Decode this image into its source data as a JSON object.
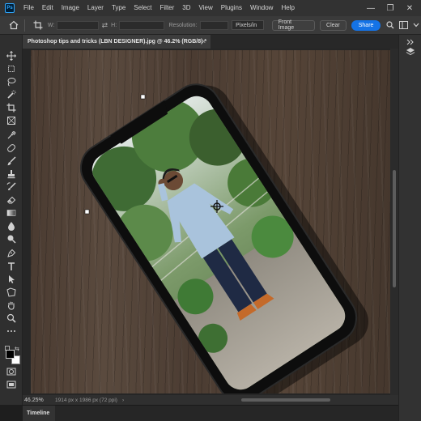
{
  "menubar": {
    "logo": "Ps",
    "items": [
      "File",
      "Edit",
      "Image",
      "Layer",
      "Type",
      "Select",
      "Filter",
      "3D",
      "View",
      "Plugins",
      "Window",
      "Help"
    ],
    "window_controls": [
      "—",
      "❐",
      "✕"
    ]
  },
  "options": {
    "w_label": "W:",
    "swap": "⇄",
    "h_label": "H:",
    "resolution_label": "Resolution:",
    "units": "Pixels/in",
    "front_image": "Front Image",
    "clear": "Clear",
    "share": "Share"
  },
  "document": {
    "tab_title": "Photoshop tips and tricks (LBN DESIGNER).jpg @ 46.2% (RGB/8) *",
    "close": "×"
  },
  "status": {
    "zoom": "46.25%",
    "doc_info": "1914 px x 1986 px (72 ppi)",
    "arrow": "›"
  },
  "timeline": {
    "label": "Timeline"
  },
  "colors": {
    "accent": "#1473e6",
    "foreground": "#000000",
    "background": "#ffffff"
  },
  "icons": {
    "tools": [
      "move-icon",
      "artboard-icon",
      "lasso-icon",
      "quick-select-icon",
      "crop-icon",
      "frame-icon",
      "eyedropper-icon",
      "healing-icon",
      "brush-icon",
      "stamp-icon",
      "history-brush-icon",
      "eraser-icon",
      "gradient-icon",
      "blur-icon",
      "dodge-icon",
      "pen-icon",
      "type-icon",
      "path-select-icon",
      "shape-icon",
      "hand-icon",
      "zoom-icon",
      "more-tools-icon"
    ],
    "right": [
      "expand-panels-icon",
      "layers-icon"
    ]
  }
}
